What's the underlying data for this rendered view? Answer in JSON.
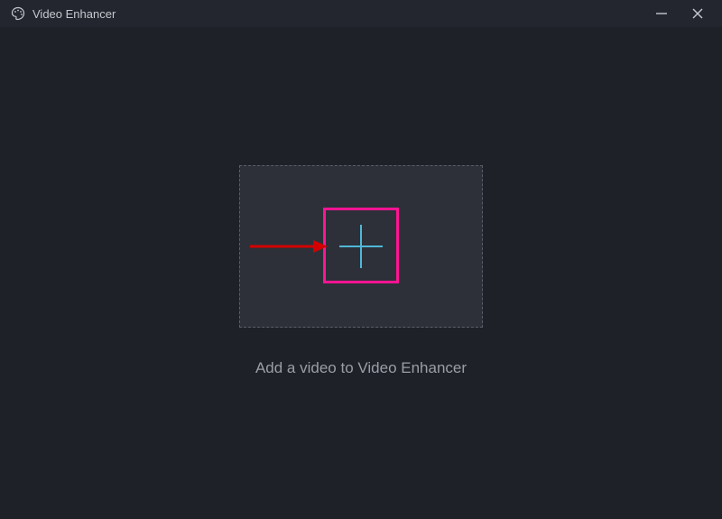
{
  "titlebar": {
    "app_name": "Video Enhancer"
  },
  "main": {
    "instruction": "Add a video to Video Enhancer"
  },
  "icons": {
    "app": "palette-icon",
    "minimize": "minimize-icon",
    "close": "close-icon",
    "plus": "plus-icon",
    "arrow_annotation": "arrow-right-annotation"
  },
  "colors": {
    "bg": "#1e2128",
    "titlebar": "#23262e",
    "dropzone_bg": "#2d3039",
    "dropzone_border": "#5a5e67",
    "plus_stroke": "#4fb8d8",
    "highlight": "#ff1493",
    "arrow": "#d40000",
    "text_muted": "#9a9ea6",
    "text_title": "#c5c8ce"
  }
}
